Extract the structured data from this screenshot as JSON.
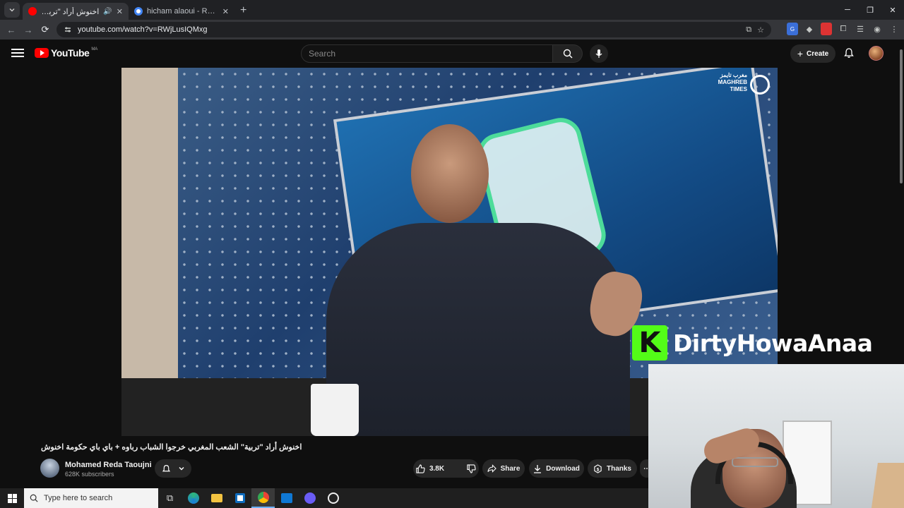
{
  "browser": {
    "tabs": [
      {
        "title": "اخنوش أراد \"تربية\" الشعب ا...",
        "active": true,
        "favicon_color": "#ff0000",
        "icon": "speaker-icon"
      },
      {
        "title": "hicham alaoui - Recherche Goo",
        "active": false,
        "favicon_color": "#4285f4",
        "icon": "google-icon"
      }
    ],
    "new_tab": "+",
    "url": "youtube.com/watch?v=RWjLusIQMxg",
    "window_controls": [
      "─",
      "❐",
      "✕"
    ]
  },
  "youtube": {
    "logo_text": "YouTube",
    "country_code": "MA",
    "search_placeholder": "Search",
    "create_label": "Create",
    "accent": "#ff0000"
  },
  "video": {
    "title": "اخنوش أراد \"تربية\" الشعب المغربي خرجوا الشباب رباوه + باي باي حكومة اخنوش",
    "channel": "Mohamed Reda Taoujni",
    "subscribers": "628K subscribers",
    "likes": "3.8K",
    "actions": {
      "share": "Share",
      "download": "Download",
      "thanks": "Thanks",
      "more": "⋯"
    },
    "watermark": "مغرب تايمز MAGHREB TIMES"
  },
  "overlay": {
    "kick_letter": "K",
    "kick_name": "DirtyHowaAnaa",
    "kick_color": "#53fc18"
  },
  "taskbar": {
    "search_placeholder": "Type here to search",
    "apps": [
      "task-view-icon",
      "edge-icon",
      "file-explorer-icon",
      "store-icon",
      "chrome-icon",
      "outlook-icon",
      "discord-icon",
      "obs-icon"
    ]
  }
}
